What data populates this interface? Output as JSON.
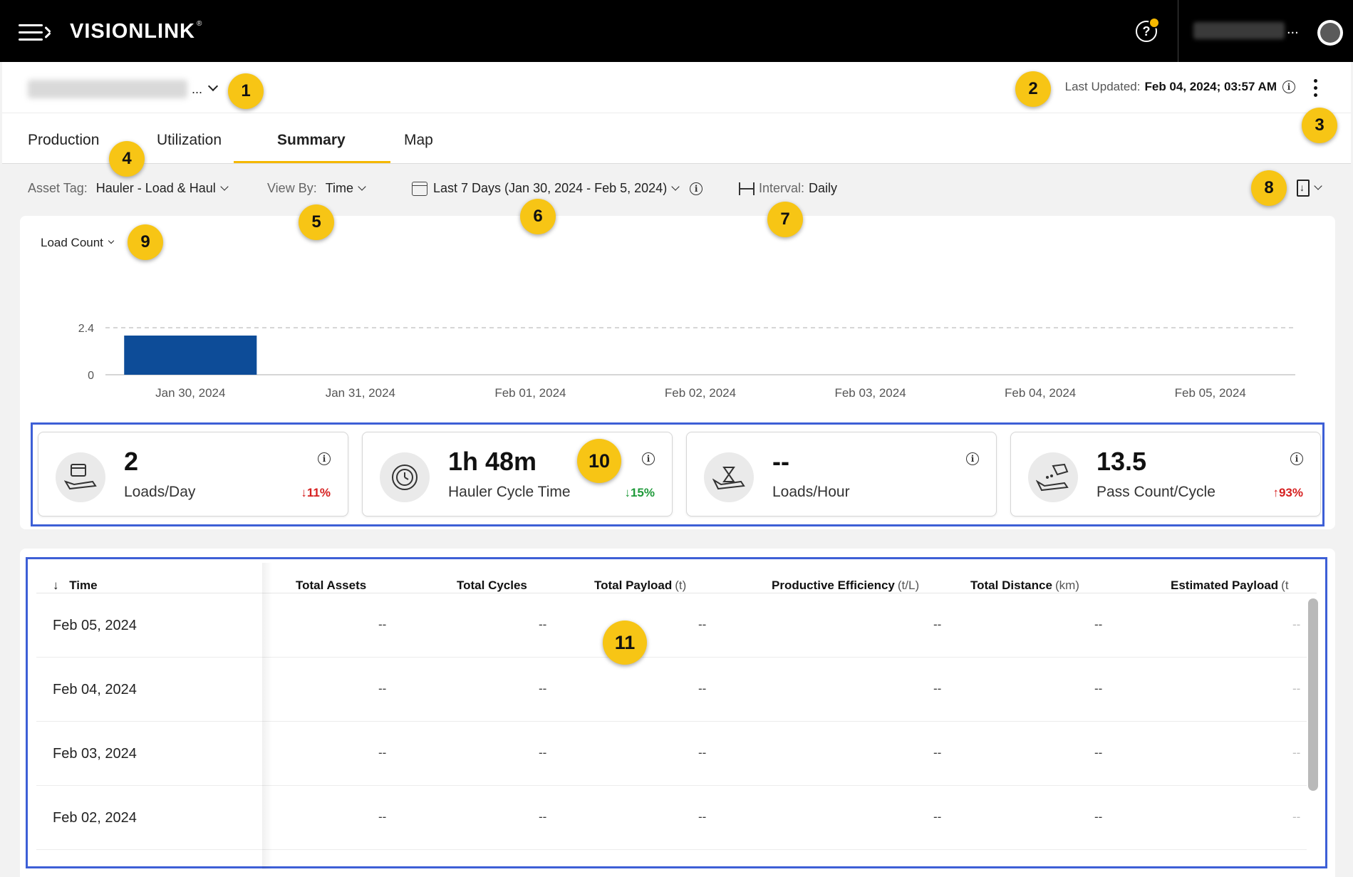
{
  "topbar": {
    "brand": "VISIONLINK",
    "brand_mark": "®",
    "help_glyph": "?",
    "user_ellipsis": "..."
  },
  "header": {
    "site_ellipsis": "...",
    "last_updated_label": "Last Updated:",
    "last_updated_value": "Feb 04, 2024; 03:57 AM"
  },
  "tabs": [
    {
      "label": "Production"
    },
    {
      "label": "Utilization"
    },
    {
      "label": "Summary",
      "active": true
    },
    {
      "label": "Map"
    }
  ],
  "filters": {
    "asset_tag_label": "Asset Tag:",
    "asset_tag_value": "Hauler - Load & Haul",
    "view_by_label": "View By:",
    "view_by_value": "Time",
    "date_range": "Last 7 Days (Jan 30, 2024 - Feb 5, 2024)",
    "interval_label": "Interval:",
    "interval_value": "Daily"
  },
  "chart": {
    "metric": "Load Count"
  },
  "chart_data": {
    "type": "bar",
    "categories": [
      "Jan 30, 2024",
      "Jan 31, 2024",
      "Feb 01, 2024",
      "Feb 02, 2024",
      "Feb 03, 2024",
      "Feb 04, 2024",
      "Feb 05, 2024"
    ],
    "values": [
      2,
      0,
      0,
      0,
      0,
      0,
      0
    ],
    "yticks": [
      0,
      2.4
    ],
    "ylim": [
      0,
      2.4
    ],
    "bar_color": "#0d4c98"
  },
  "kpis": [
    {
      "value": "2",
      "label": "Loads/Day",
      "trend": "↓11%",
      "icon": "calendar-loader-icon"
    },
    {
      "value": "1h 48m",
      "label": "Hauler Cycle Time",
      "trend": "↓15%",
      "icon": "cycle-timer-icon"
    },
    {
      "value": "--",
      "label": "Loads/Hour",
      "trend": "",
      "icon": "hourglass-loader-icon"
    },
    {
      "value": "13.5",
      "label": "Pass Count/Cycle",
      "trend": "↑93%",
      "icon": "bucket-pass-icon"
    }
  ],
  "table": {
    "sort_glyph": "↓",
    "columns": [
      {
        "label": "Time",
        "unit": ""
      },
      {
        "label": "Total Assets",
        "unit": ""
      },
      {
        "label": "Total Cycles",
        "unit": ""
      },
      {
        "label": "Total Payload",
        "unit": "(t)"
      },
      {
        "label": "Productive Efficiency",
        "unit": "(t/L)"
      },
      {
        "label": "Total Distance",
        "unit": "(km)"
      },
      {
        "label": "Estimated Payload",
        "unit": "(t"
      }
    ],
    "rows": [
      {
        "time": "Feb 05, 2024",
        "c1": "--",
        "c2": "--",
        "c3": "--",
        "c4": "--",
        "c5": "--",
        "c6": "--"
      },
      {
        "time": "Feb 04, 2024",
        "c1": "--",
        "c2": "--",
        "c3": "--",
        "c4": "--",
        "c5": "--",
        "c6": "--"
      },
      {
        "time": "Feb 03, 2024",
        "c1": "--",
        "c2": "--",
        "c3": "--",
        "c4": "--",
        "c5": "--",
        "c6": "--"
      },
      {
        "time": "Feb 02, 2024",
        "c1": "--",
        "c2": "--",
        "c3": "--",
        "c4": "--",
        "c5": "--",
        "c6": "--"
      }
    ]
  },
  "callouts": [
    "1",
    "2",
    "3",
    "4",
    "5",
    "6",
    "7",
    "8",
    "9",
    "10",
    "11"
  ],
  "colors": {
    "accent": "#f5b800",
    "frame": "#3d5fd6",
    "bar": "#0d4c98",
    "bad": "#d62020",
    "good": "#1f9a3a"
  }
}
